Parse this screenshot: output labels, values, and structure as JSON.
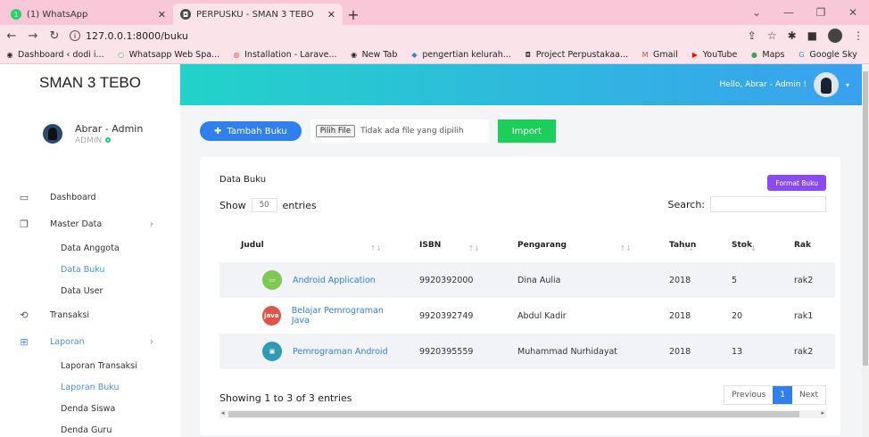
{
  "browser": {
    "tabs": [
      {
        "title": "(1) WhatsApp",
        "favicon": "whatsapp-icon",
        "color": "#25d366",
        "glyph": "1"
      },
      {
        "title": "PERPUSKU - SMAN 3 TEBO",
        "favicon": "app-icon",
        "color": "#4a4a4a",
        "glyph": "◘"
      }
    ],
    "new_tab": "+",
    "url": "127.0.0.1:8000/buku",
    "bookmarks": [
      {
        "label": "Dashboard ‹ dodi i...",
        "glyph": "◉",
        "color": "#222"
      },
      {
        "label": "Whatsapp Web Spa...",
        "glyph": "○",
        "color": "#25d366"
      },
      {
        "label": "Installation - Larave...",
        "glyph": "◍",
        "color": "#f05340"
      },
      {
        "label": "New Tab",
        "glyph": "◉",
        "color": "#222"
      },
      {
        "label": "pengertian kelurah...",
        "glyph": "◆",
        "color": "#3b7de0"
      },
      {
        "label": "Project Perpustakaa...",
        "glyph": "◘",
        "color": "#4a4a4a"
      },
      {
        "label": "Gmail",
        "glyph": "M",
        "color": "#ea4335"
      },
      {
        "label": "YouTube",
        "glyph": "▶",
        "color": "#ff0000"
      },
      {
        "label": "Maps",
        "glyph": "●",
        "color": "#34a853"
      },
      {
        "label": "Google Sky",
        "glyph": "G",
        "color": "#4285f4"
      }
    ],
    "bookmarks_more": "»"
  },
  "sidebar": {
    "brand": "SMAN 3 TEBO",
    "user_name": "Abrar - Admin",
    "user_role": "ADMIN",
    "menu": {
      "dashboard": "Dashboard",
      "master_data": "Master Data",
      "data_anggota": "Data Anggota",
      "data_buku": "Data Buku",
      "data_user": "Data User",
      "transaksi": "Transaksi",
      "laporan": "Laporan",
      "laporan_transaksi": "Laporan Transaksi",
      "laporan_buku": "Laporan Buku",
      "denda_siswa": "Denda Siswa",
      "denda_guru": "Denda Guru"
    }
  },
  "topnav": {
    "greeting": "Hello, Abrar - Admin !"
  },
  "actions": {
    "add_label": "Tambah Buku",
    "file_pick": "Pilih File",
    "file_none": "Tidak ada file yang dipilih",
    "import_label": "Import"
  },
  "card": {
    "title": "Data Buku",
    "format_label": "Format Buku",
    "show_label": "Show",
    "entries_value": "50",
    "entries_label": "entries",
    "search_label": "Search:",
    "info": "Showing 1 to 3 of 3 entries",
    "pager": {
      "previous": "Previous",
      "current": "1",
      "next": "Next"
    }
  },
  "table": {
    "headers": [
      "Judul",
      "ISBN",
      "Pengarang",
      "Tahun",
      "Stok",
      "Rak"
    ],
    "rows": [
      {
        "judul": "Android Application",
        "isbn": "9920392000",
        "pengarang": "Dina Aulia",
        "tahun": "2018",
        "stok": "5",
        "rak": "rak2",
        "thumb_color": "#7ec850",
        "thumb_text": "▭"
      },
      {
        "judul": "Belajar Pemrograman Java",
        "isbn": "9920392749",
        "pengarang": "Abdul Kadir",
        "tahun": "2018",
        "stok": "20",
        "rak": "rak1",
        "thumb_color": "#e0534a",
        "thumb_text": "java"
      },
      {
        "judul": "Pemrograman Android",
        "isbn": "9920395559",
        "pengarang": "Muhammad Nurhidayat",
        "tahun": "2018",
        "stok": "13",
        "rak": "rak2",
        "thumb_color": "#2e9bb5",
        "thumb_text": "▣"
      }
    ]
  },
  "colors": {
    "accent": "#2f80ed",
    "import": "#1bcf5a",
    "format": "#8a4cf0",
    "topnav_start": "#22d3c9",
    "topnav_end": "#3aa0f0"
  }
}
